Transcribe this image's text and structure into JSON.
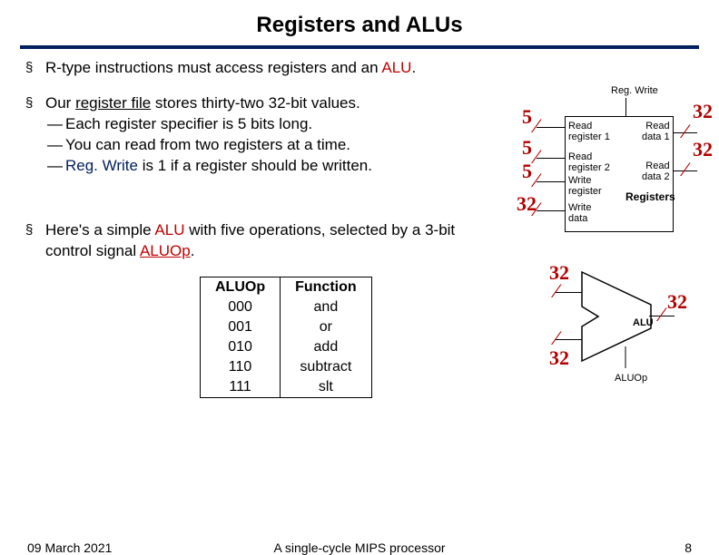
{
  "title": "Registers and ALUs",
  "bullets": {
    "b1_pre": "R-type instructions must access registers and an ",
    "b1_red": "ALU",
    "b1_post": ".",
    "b2_pre": "Our ",
    "b2_u": "register file",
    "b2_post": " stores thirty-two 32-bit values.",
    "b2s1": "Each register specifier is 5 bits long.",
    "b2s2": "You can read from two registers at a time.",
    "b2s3_pre": "",
    "b2s3_blue": "Reg. Write",
    "b2s3_post": " is 1 if a register should be written.",
    "b3_pre": "Here's a simple ",
    "b3_red": "ALU",
    "b3_mid": " with five operations, selected by a 3-bit control signal ",
    "b3_redu": "ALUOp",
    "b3_post": "."
  },
  "reg": {
    "regwrite": "Reg. Write",
    "rr1": "Read\nregister 1",
    "rr2": "Read\nregister 2",
    "wr": "Write\nregister",
    "wd": "Write\ndata",
    "rd1": "Read\ndata 1",
    "rd2": "Read\ndata 2",
    "registers": "Registers",
    "n1": "5",
    "n2": "5",
    "n3": "5",
    "n4": "32",
    "no1": "32",
    "no2": "32"
  },
  "alu": {
    "label": "ALU",
    "aluop": "ALUOp",
    "n_in1": "32",
    "n_in2": "32",
    "n_out": "32"
  },
  "table": {
    "h1": "ALUOp",
    "h2": "Function",
    "rows": [
      {
        "op": "000",
        "fn": "and"
      },
      {
        "op": "001",
        "fn": "or"
      },
      {
        "op": "010",
        "fn": "add"
      },
      {
        "op": "110",
        "fn": "subtract"
      },
      {
        "op": "111",
        "fn": "slt"
      }
    ]
  },
  "footer": {
    "date": "09 March 2021",
    "center": "A single-cycle MIPS processor",
    "page": "8"
  },
  "chart_data": [
    {
      "type": "table",
      "title": "ALUOp → Function",
      "columns": [
        "ALUOp",
        "Function"
      ],
      "rows": [
        [
          "000",
          "and"
        ],
        [
          "001",
          "or"
        ],
        [
          "010",
          "add"
        ],
        [
          "110",
          "subtract"
        ],
        [
          "111",
          "slt"
        ]
      ]
    }
  ]
}
